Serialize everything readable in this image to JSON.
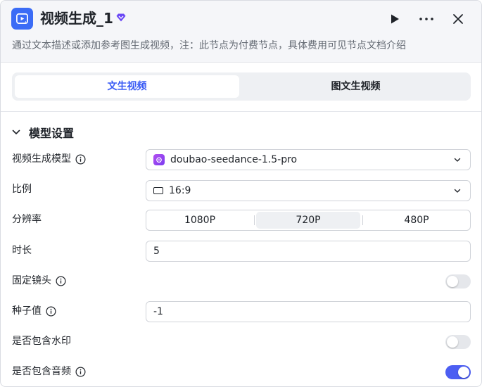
{
  "header": {
    "title": "视频生成_1",
    "description": "通过文本描述或添加参考图生成视频，注：此节点为付费节点，具体费用可见节点文档介绍",
    "accent": "#3b6cf6"
  },
  "tabs": [
    {
      "label": "文生视频",
      "active": true
    },
    {
      "label": "图文生视频",
      "active": false
    }
  ],
  "section": {
    "label": "模型设置"
  },
  "fields": {
    "model": {
      "label": "视频生成模型",
      "value": "doubao-seedance-1.5-pro"
    },
    "ratio": {
      "label": "比例",
      "value": "16:9"
    },
    "resolution": {
      "label": "分辨率",
      "options": [
        "1080P",
        "720P",
        "480P"
      ],
      "selected": "720P"
    },
    "duration": {
      "label": "时长",
      "value": "5"
    },
    "fixed_camera": {
      "label": "固定镜头",
      "enabled": false
    },
    "seed": {
      "label": "种子值",
      "value": "-1"
    },
    "watermark": {
      "label": "是否包含水印",
      "enabled": false
    },
    "audio": {
      "label": "是否包含音频",
      "enabled": true
    }
  },
  "colors": {
    "primary": "#4c5ef2",
    "tab_active_text": "#3b5cf5"
  }
}
